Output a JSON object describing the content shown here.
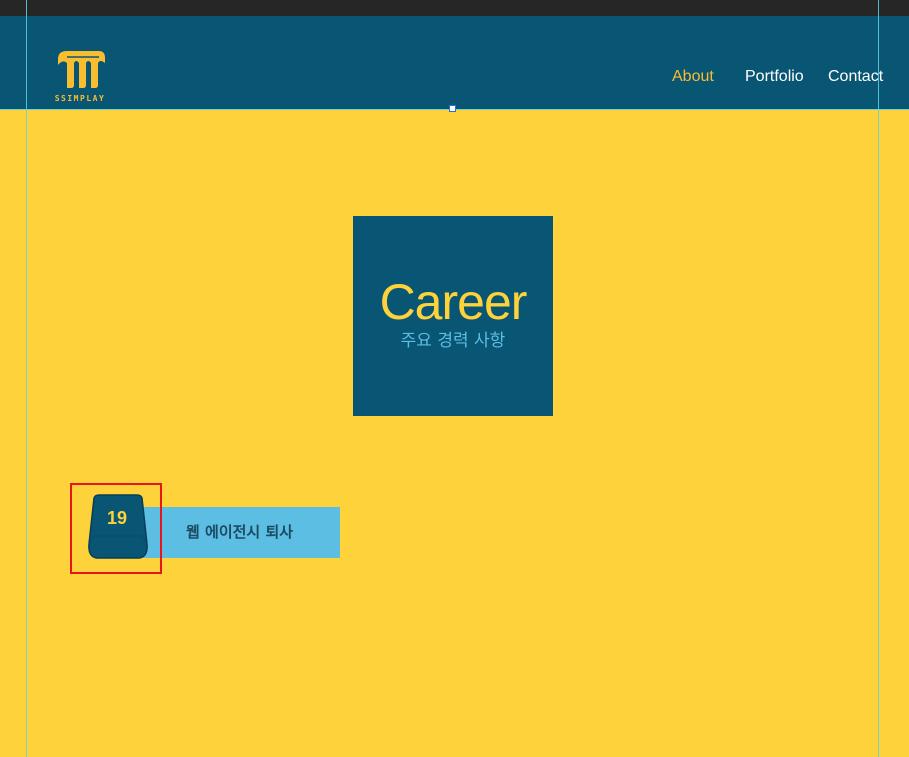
{
  "logo": {
    "text": "SSIMPLAY",
    "icon": "ssimplay-logo-icon"
  },
  "nav": {
    "items": [
      {
        "label": "About",
        "active": true
      },
      {
        "label": "Portfolio",
        "active": false
      },
      {
        "label": "Contact",
        "active": false
      }
    ]
  },
  "career": {
    "title": "Career",
    "subtitle": "주요 경력 사항"
  },
  "timeline": {
    "items": [
      {
        "year": "19",
        "label": "웹 에이전시 퇴사"
      }
    ]
  },
  "colors": {
    "background": "#FED23A",
    "header": "#095574",
    "accent": "#F9BE30",
    "event_bar": "#5BBEE2",
    "guides": "#5FD3E3",
    "highlight": "#E8161B"
  }
}
